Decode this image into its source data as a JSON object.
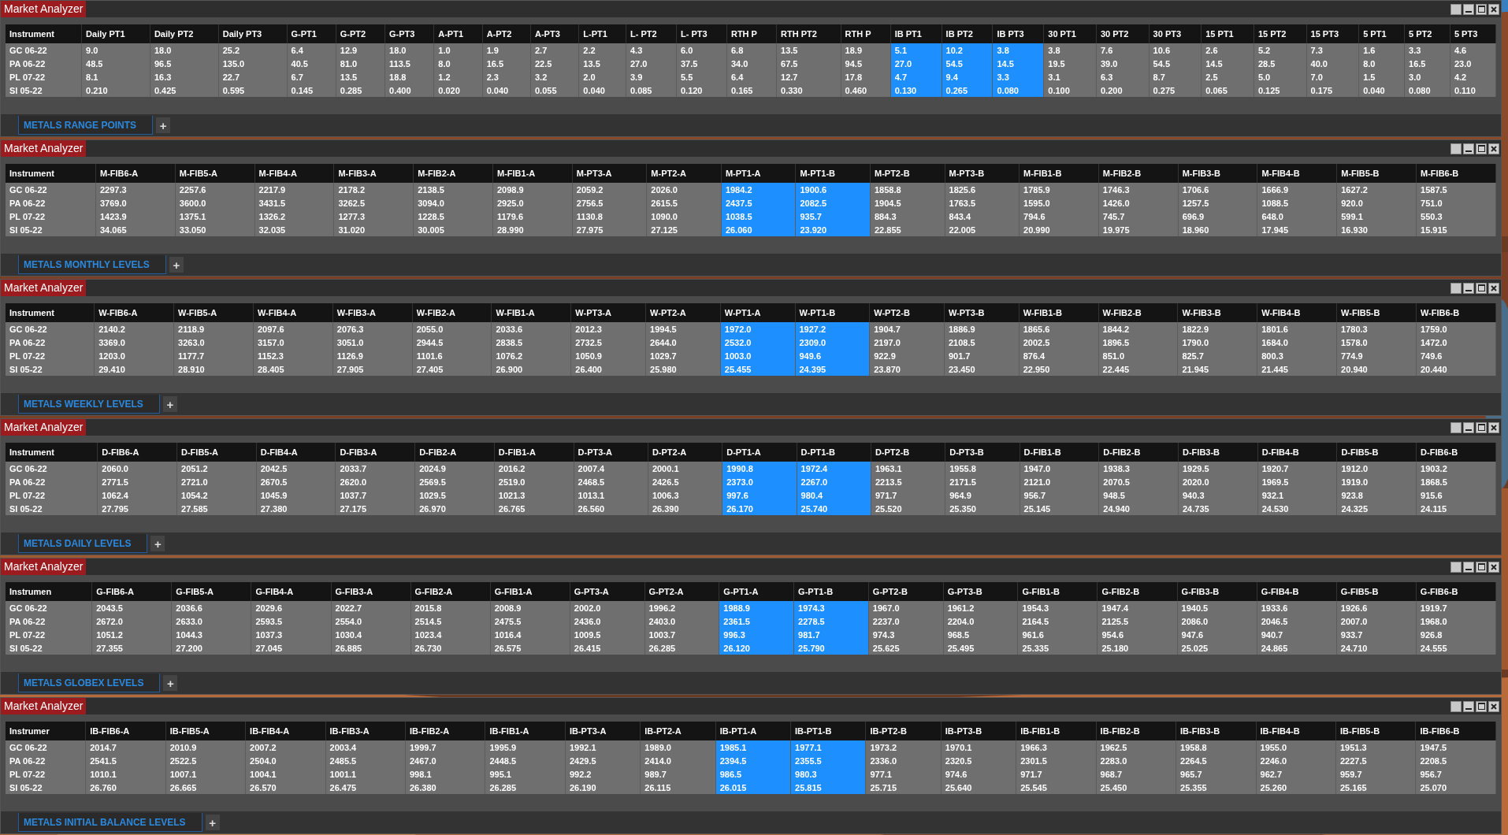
{
  "windows": [
    {
      "title": "Market Analyzer",
      "tab": "METALS RANGE POINTS",
      "add_tab": "+",
      "columns": [
        {
          "label": "Instrument",
          "highlighted": false
        },
        {
          "label": "Daily PT1",
          "highlighted": false
        },
        {
          "label": "Daily PT2",
          "highlighted": false
        },
        {
          "label": "Daily PT3",
          "highlighted": false
        },
        {
          "label": "G-PT1",
          "highlighted": false
        },
        {
          "label": "G-PT2",
          "highlighted": false
        },
        {
          "label": "G-PT3",
          "highlighted": false
        },
        {
          "label": "A-PT1",
          "highlighted": false
        },
        {
          "label": "A-PT2",
          "highlighted": false
        },
        {
          "label": "A-PT3",
          "highlighted": false
        },
        {
          "label": "L-PT1",
          "highlighted": false
        },
        {
          "label": "L- PT2",
          "highlighted": false
        },
        {
          "label": "L- PT3",
          "highlighted": false
        },
        {
          "label": "RTH P",
          "highlighted": false
        },
        {
          "label": "RTH PT2",
          "highlighted": false
        },
        {
          "label": "RTH P",
          "highlighted": false
        },
        {
          "label": "IB PT1",
          "highlighted": true
        },
        {
          "label": "IB PT2",
          "highlighted": true
        },
        {
          "label": "IB PT3",
          "highlighted": true
        },
        {
          "label": "30 PT1",
          "highlighted": false
        },
        {
          "label": "30 PT2",
          "highlighted": false
        },
        {
          "label": "30 PT3",
          "highlighted": false
        },
        {
          "label": "15 PT1",
          "highlighted": false
        },
        {
          "label": "15 PT2",
          "highlighted": false
        },
        {
          "label": "15 PT3",
          "highlighted": false
        },
        {
          "label": "5 PT1",
          "highlighted": false
        },
        {
          "label": "5 PT2",
          "highlighted": false
        },
        {
          "label": "5 PT3",
          "highlighted": false
        }
      ],
      "rows": [
        [
          "GC 06-22",
          "9.0",
          "18.0",
          "25.2",
          "6.4",
          "12.9",
          "18.0",
          "1.0",
          "1.9",
          "2.7",
          "2.2",
          "4.3",
          "6.0",
          "6.8",
          "13.5",
          "18.9",
          "5.1",
          "10.2",
          "3.8",
          "3.8",
          "7.6",
          "10.6",
          "2.6",
          "5.2",
          "7.3",
          "1.6",
          "3.3",
          "4.6"
        ],
        [
          "PA 06-22",
          "48.5",
          "96.5",
          "135.0",
          "40.5",
          "81.0",
          "113.5",
          "8.0",
          "16.5",
          "22.5",
          "13.5",
          "27.0",
          "37.5",
          "34.0",
          "67.5",
          "94.5",
          "27.0",
          "54.5",
          "14.5",
          "19.5",
          "39.0",
          "54.5",
          "14.5",
          "28.5",
          "40.0",
          "8.0",
          "16.5",
          "23.0"
        ],
        [
          "PL 07-22",
          "8.1",
          "16.3",
          "22.7",
          "6.7",
          "13.5",
          "18.8",
          "1.2",
          "2.3",
          "3.2",
          "2.0",
          "3.9",
          "5.5",
          "6.4",
          "12.7",
          "17.8",
          "4.7",
          "9.4",
          "3.3",
          "3.1",
          "6.3",
          "8.7",
          "2.5",
          "5.0",
          "7.0",
          "1.5",
          "3.0",
          "4.2"
        ],
        [
          "SI 05-22",
          "0.210",
          "0.425",
          "0.595",
          "0.145",
          "0.285",
          "0.400",
          "0.020",
          "0.040",
          "0.055",
          "0.040",
          "0.085",
          "0.120",
          "0.165",
          "0.330",
          "0.460",
          "0.130",
          "0.265",
          "0.080",
          "0.100",
          "0.200",
          "0.275",
          "0.065",
          "0.125",
          "0.175",
          "0.040",
          "0.080",
          "0.110"
        ]
      ]
    },
    {
      "title": "Market Analyzer",
      "tab": "METALS MONTHLY LEVELS",
      "add_tab": "+",
      "columns": [
        {
          "label": "Instrument",
          "highlighted": false
        },
        {
          "label": "M-FIB6-A",
          "highlighted": false
        },
        {
          "label": "M-FIB5-A",
          "highlighted": false
        },
        {
          "label": "M-FIB4-A",
          "highlighted": false
        },
        {
          "label": "M-FIB3-A",
          "highlighted": false
        },
        {
          "label": "M-FIB2-A",
          "highlighted": false
        },
        {
          "label": "M-FIB1-A",
          "highlighted": false
        },
        {
          "label": "M-PT3-A",
          "highlighted": false
        },
        {
          "label": "M-PT2-A",
          "highlighted": false
        },
        {
          "label": "M-PT1-A",
          "highlighted": true
        },
        {
          "label": "M-PT1-B",
          "highlighted": true
        },
        {
          "label": "M-PT2-B",
          "highlighted": false
        },
        {
          "label": "M-PT3-B",
          "highlighted": false
        },
        {
          "label": "M-FIB1-B",
          "highlighted": false
        },
        {
          "label": "M-FIB2-B",
          "highlighted": false
        },
        {
          "label": "M-FIB3-B",
          "highlighted": false
        },
        {
          "label": "M-FIB4-B",
          "highlighted": false
        },
        {
          "label": "M-FIB5-B",
          "highlighted": false
        },
        {
          "label": "M-FIB6-B",
          "highlighted": false
        }
      ],
      "rows": [
        [
          "GC 06-22",
          "2297.3",
          "2257.6",
          "2217.9",
          "2178.2",
          "2138.5",
          "2098.9",
          "2059.2",
          "2026.0",
          "1984.2",
          "1900.6",
          "1858.8",
          "1825.6",
          "1785.9",
          "1746.3",
          "1706.6",
          "1666.9",
          "1627.2",
          "1587.5"
        ],
        [
          "PA 06-22",
          "3769.0",
          "3600.0",
          "3431.5",
          "3262.5",
          "3094.0",
          "2925.0",
          "2756.5",
          "2615.5",
          "2437.5",
          "2082.5",
          "1904.5",
          "1763.5",
          "1595.0",
          "1426.0",
          "1257.5",
          "1088.5",
          "920.0",
          "751.0"
        ],
        [
          "PL 07-22",
          "1423.9",
          "1375.1",
          "1326.2",
          "1277.3",
          "1228.5",
          "1179.6",
          "1130.8",
          "1090.0",
          "1038.5",
          "935.7",
          "884.3",
          "843.4",
          "794.6",
          "745.7",
          "696.9",
          "648.0",
          "599.1",
          "550.3"
        ],
        [
          "SI 05-22",
          "34.065",
          "33.050",
          "32.035",
          "31.020",
          "30.005",
          "28.990",
          "27.975",
          "27.125",
          "26.060",
          "23.920",
          "22.855",
          "22.005",
          "20.990",
          "19.975",
          "18.960",
          "17.945",
          "16.930",
          "15.915"
        ]
      ]
    },
    {
      "title": "Market Analyzer",
      "tab": "METALS WEEKLY LEVELS",
      "add_tab": "+",
      "columns": [
        {
          "label": "Instrument",
          "highlighted": false
        },
        {
          "label": "W-FIB6-A",
          "highlighted": false
        },
        {
          "label": "W-FIB5-A",
          "highlighted": false
        },
        {
          "label": "W-FIB4-A",
          "highlighted": false
        },
        {
          "label": "W-FIB3-A",
          "highlighted": false
        },
        {
          "label": "W-FIB2-A",
          "highlighted": false
        },
        {
          "label": "W-FIB1-A",
          "highlighted": false
        },
        {
          "label": "W-PT3-A",
          "highlighted": false
        },
        {
          "label": "W-PT2-A",
          "highlighted": false
        },
        {
          "label": "W-PT1-A",
          "highlighted": true
        },
        {
          "label": "W-PT1-B",
          "highlighted": true
        },
        {
          "label": "W-PT2-B",
          "highlighted": false
        },
        {
          "label": "W-PT3-B",
          "highlighted": false
        },
        {
          "label": "W-FIB1-B",
          "highlighted": false
        },
        {
          "label": "W-FIB2-B",
          "highlighted": false
        },
        {
          "label": "W-FIB3-B",
          "highlighted": false
        },
        {
          "label": "W-FIB4-B",
          "highlighted": false
        },
        {
          "label": "W-FIB5-B",
          "highlighted": false
        },
        {
          "label": "W-FIB6-B",
          "highlighted": false
        }
      ],
      "rows": [
        [
          "GC 06-22",
          "2140.2",
          "2118.9",
          "2097.6",
          "2076.3",
          "2055.0",
          "2033.6",
          "2012.3",
          "1994.5",
          "1972.0",
          "1927.2",
          "1904.7",
          "1886.9",
          "1865.6",
          "1844.2",
          "1822.9",
          "1801.6",
          "1780.3",
          "1759.0"
        ],
        [
          "PA 06-22",
          "3369.0",
          "3263.0",
          "3157.0",
          "3051.0",
          "2944.5",
          "2838.5",
          "2732.5",
          "2644.0",
          "2532.0",
          "2309.0",
          "2197.0",
          "2108.5",
          "2002.5",
          "1896.5",
          "1790.0",
          "1684.0",
          "1578.0",
          "1472.0"
        ],
        [
          "PL 07-22",
          "1203.0",
          "1177.7",
          "1152.3",
          "1126.9",
          "1101.6",
          "1076.2",
          "1050.9",
          "1029.7",
          "1003.0",
          "949.6",
          "922.9",
          "901.7",
          "876.4",
          "851.0",
          "825.7",
          "800.3",
          "774.9",
          "749.6"
        ],
        [
          "SI 05-22",
          "29.410",
          "28.910",
          "28.405",
          "27.905",
          "27.405",
          "26.900",
          "26.400",
          "25.980",
          "25.455",
          "24.395",
          "23.870",
          "23.450",
          "22.950",
          "22.445",
          "21.945",
          "21.445",
          "20.940",
          "20.440"
        ]
      ]
    },
    {
      "title": "Market Analyzer",
      "tab": "METALS DAILY LEVELS",
      "add_tab": "+",
      "columns": [
        {
          "label": "Instrument",
          "highlighted": false
        },
        {
          "label": "D-FIB6-A",
          "highlighted": false
        },
        {
          "label": "D-FIB5-A",
          "highlighted": false
        },
        {
          "label": "D-FIB4-A",
          "highlighted": false
        },
        {
          "label": "D-FIB3-A",
          "highlighted": false
        },
        {
          "label": "D-FIB2-A",
          "highlighted": false
        },
        {
          "label": "D-FIB1-A",
          "highlighted": false
        },
        {
          "label": "D-PT3-A",
          "highlighted": false
        },
        {
          "label": "D-PT2-A",
          "highlighted": false
        },
        {
          "label": "D-PT1-A",
          "highlighted": true
        },
        {
          "label": "D-PT1-B",
          "highlighted": true
        },
        {
          "label": "D-PT2-B",
          "highlighted": false
        },
        {
          "label": "D-PT3-B",
          "highlighted": false
        },
        {
          "label": "D-FIB1-B",
          "highlighted": false
        },
        {
          "label": "D-FIB2-B",
          "highlighted": false
        },
        {
          "label": "D-FIB3-B",
          "highlighted": false
        },
        {
          "label": "D-FIB4-B",
          "highlighted": false
        },
        {
          "label": "D-FIB5-B",
          "highlighted": false
        },
        {
          "label": "D-FIB6-B",
          "highlighted": false
        }
      ],
      "rows": [
        [
          "GC 06-22",
          "2060.0",
          "2051.2",
          "2042.5",
          "2033.7",
          "2024.9",
          "2016.2",
          "2007.4",
          "2000.1",
          "1990.8",
          "1972.4",
          "1963.1",
          "1955.8",
          "1947.0",
          "1938.3",
          "1929.5",
          "1920.7",
          "1912.0",
          "1903.2"
        ],
        [
          "PA 06-22",
          "2771.5",
          "2721.0",
          "2670.5",
          "2620.0",
          "2569.5",
          "2519.0",
          "2468.5",
          "2426.5",
          "2373.0",
          "2267.0",
          "2213.5",
          "2171.5",
          "2121.0",
          "2070.5",
          "2020.0",
          "1969.5",
          "1919.0",
          "1868.5"
        ],
        [
          "PL 07-22",
          "1062.4",
          "1054.2",
          "1045.9",
          "1037.7",
          "1029.5",
          "1021.3",
          "1013.1",
          "1006.3",
          "997.6",
          "980.4",
          "971.7",
          "964.9",
          "956.7",
          "948.5",
          "940.3",
          "932.1",
          "923.8",
          "915.6"
        ],
        [
          "SI 05-22",
          "27.795",
          "27.585",
          "27.380",
          "27.175",
          "26.970",
          "26.765",
          "26.560",
          "26.390",
          "26.170",
          "25.740",
          "25.520",
          "25.350",
          "25.145",
          "24.940",
          "24.735",
          "24.530",
          "24.325",
          "24.115"
        ]
      ]
    },
    {
      "title": "Market Analyzer",
      "tab": "METALS GLOBEX LEVELS",
      "add_tab": "+",
      "columns": [
        {
          "label": "Instrumen",
          "highlighted": false
        },
        {
          "label": "G-FIB6-A",
          "highlighted": false
        },
        {
          "label": "G-FIB5-A",
          "highlighted": false
        },
        {
          "label": "G-FIB4-A",
          "highlighted": false
        },
        {
          "label": "G-FIB3-A",
          "highlighted": false
        },
        {
          "label": "G-FIB2-A",
          "highlighted": false
        },
        {
          "label": "G-FIB1-A",
          "highlighted": false
        },
        {
          "label": "G-PT3-A",
          "highlighted": false
        },
        {
          "label": "G-PT2-A",
          "highlighted": false
        },
        {
          "label": "G-PT1-A",
          "highlighted": true
        },
        {
          "label": "G-PT1-B",
          "highlighted": true
        },
        {
          "label": "G-PT2-B",
          "highlighted": false
        },
        {
          "label": "G-PT3-B",
          "highlighted": false
        },
        {
          "label": "G-FIB1-B",
          "highlighted": false
        },
        {
          "label": "G-FIB2-B",
          "highlighted": false
        },
        {
          "label": "G-FIB3-B",
          "highlighted": false
        },
        {
          "label": "G-FIB4-B",
          "highlighted": false
        },
        {
          "label": "G-FIB5-B",
          "highlighted": false
        },
        {
          "label": "G-FIB6-B",
          "highlighted": false
        }
      ],
      "rows": [
        [
          "GC 06-22",
          "2043.5",
          "2036.6",
          "2029.6",
          "2022.7",
          "2015.8",
          "2008.9",
          "2002.0",
          "1996.2",
          "1988.9",
          "1974.3",
          "1967.0",
          "1961.2",
          "1954.3",
          "1947.4",
          "1940.5",
          "1933.6",
          "1926.6",
          "1919.7"
        ],
        [
          "PA 06-22",
          "2672.0",
          "2633.0",
          "2593.5",
          "2554.0",
          "2514.5",
          "2475.5",
          "2436.0",
          "2403.0",
          "2361.5",
          "2278.5",
          "2237.0",
          "2204.0",
          "2164.5",
          "2125.5",
          "2086.0",
          "2046.5",
          "2007.0",
          "1968.0"
        ],
        [
          "PL 07-22",
          "1051.2",
          "1044.3",
          "1037.3",
          "1030.4",
          "1023.4",
          "1016.4",
          "1009.5",
          "1003.7",
          "996.3",
          "981.7",
          "974.3",
          "968.5",
          "961.6",
          "954.6",
          "947.6",
          "940.7",
          "933.7",
          "926.8"
        ],
        [
          "SI 05-22",
          "27.355",
          "27.200",
          "27.045",
          "26.885",
          "26.730",
          "26.575",
          "26.415",
          "26.285",
          "26.120",
          "25.790",
          "25.625",
          "25.495",
          "25.335",
          "25.180",
          "25.025",
          "24.865",
          "24.710",
          "24.555"
        ]
      ]
    },
    {
      "title": "Market Analyzer",
      "tab": "METALS INITIAL BALANCE LEVELS",
      "add_tab": "+",
      "columns": [
        {
          "label": "Instrumer",
          "highlighted": false
        },
        {
          "label": "IB-FIB6-A",
          "highlighted": false
        },
        {
          "label": "IB-FIB5-A",
          "highlighted": false
        },
        {
          "label": "IB-FIB4-A",
          "highlighted": false
        },
        {
          "label": "IB-FIB3-A",
          "highlighted": false
        },
        {
          "label": "IB-FIB2-A",
          "highlighted": false
        },
        {
          "label": "IB-FIB1-A",
          "highlighted": false
        },
        {
          "label": "IB-PT3-A",
          "highlighted": false
        },
        {
          "label": "IB-PT2-A",
          "highlighted": false
        },
        {
          "label": "IB-PT1-A",
          "highlighted": true
        },
        {
          "label": "IB-PT1-B",
          "highlighted": true
        },
        {
          "label": "IB-PT2-B",
          "highlighted": false
        },
        {
          "label": "IB-PT3-B",
          "highlighted": false
        },
        {
          "label": "IB-FIB1-B",
          "highlighted": false
        },
        {
          "label": "IB-FIB2-B",
          "highlighted": false
        },
        {
          "label": "IB-FIB3-B",
          "highlighted": false
        },
        {
          "label": "IB-FIB4-B",
          "highlighted": false
        },
        {
          "label": "IB-FIB5-B",
          "highlighted": false
        },
        {
          "label": "IB-FIB6-B",
          "highlighted": false
        }
      ],
      "rows": [
        [
          "GC 06-22",
          "2014.7",
          "2010.9",
          "2007.2",
          "2003.4",
          "1999.7",
          "1995.9",
          "1992.1",
          "1989.0",
          "1985.1",
          "1977.1",
          "1973.2",
          "1970.1",
          "1966.3",
          "1962.5",
          "1958.8",
          "1955.0",
          "1951.3",
          "1947.5"
        ],
        [
          "PA 06-22",
          "2541.5",
          "2522.5",
          "2504.0",
          "2485.5",
          "2467.0",
          "2448.5",
          "2429.5",
          "2414.0",
          "2394.5",
          "2355.5",
          "2336.0",
          "2320.5",
          "2301.5",
          "2283.0",
          "2264.5",
          "2246.0",
          "2227.5",
          "2208.5"
        ],
        [
          "PL 07-22",
          "1010.1",
          "1007.1",
          "1004.1",
          "1001.1",
          "998.1",
          "995.1",
          "992.2",
          "989.7",
          "986.5",
          "980.3",
          "977.1",
          "974.6",
          "971.7",
          "968.7",
          "965.7",
          "962.7",
          "959.7",
          "956.7"
        ],
        [
          "SI 05-22",
          "26.760",
          "26.665",
          "26.570",
          "26.475",
          "26.380",
          "26.285",
          "26.190",
          "26.115",
          "26.015",
          "25.815",
          "25.715",
          "25.640",
          "25.545",
          "25.450",
          "25.355",
          "25.260",
          "25.165",
          "25.070"
        ]
      ]
    }
  ]
}
